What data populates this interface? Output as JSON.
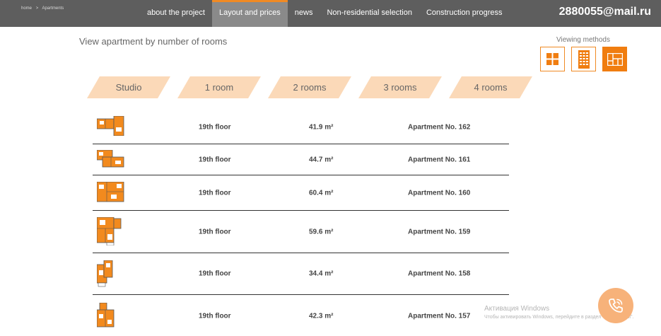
{
  "breadcrumbs": [
    "home",
    ">",
    "Apartments"
  ],
  "nav": {
    "items": [
      {
        "label": "about the project",
        "active": false
      },
      {
        "label": "Layout and prices",
        "active": true
      },
      {
        "label": "news",
        "active": false
      },
      {
        "label": "Non-residential selection",
        "active": false
      },
      {
        "label": "Construction progress",
        "active": false
      }
    ],
    "email": "2880055@mail.ru"
  },
  "section_title": "View apartment by number of rooms",
  "viewing": {
    "label": "Viewing methods",
    "modes": [
      "grid-view-icon",
      "building-facade-icon",
      "floor-plan-view-icon"
    ],
    "active_mode": "floor-plan-view-icon"
  },
  "room_tabs": [
    "Studio",
    "1 room",
    "2 rooms",
    "3 rooms",
    "4 rooms"
  ],
  "apartments": [
    {
      "floor": "19th floor",
      "area": "41.9 m²",
      "apartment": "Apartment No. 162"
    },
    {
      "floor": "19th floor",
      "area": "44.7 m²",
      "apartment": "Apartment No. 161"
    },
    {
      "floor": "19th floor",
      "area": "60.4 m²",
      "apartment": "Apartment No. 160"
    },
    {
      "floor": "19th floor",
      "area": "59.6 m²",
      "apartment": "Apartment No. 159"
    },
    {
      "floor": "19th floor",
      "area": "34.4 m²",
      "apartment": "Apartment No. 158"
    },
    {
      "floor": "19th floor",
      "area": "42.3 m²",
      "apartment": "Apartment No. 157"
    }
  ],
  "windows_watermark": {
    "line1": "Активация Windows",
    "line2": "Чтобы активировать Windows, перейдите в раздел \"Параметры\"."
  },
  "call_button_icon": "phone-call-icon",
  "colors": {
    "accent": "#f07d10",
    "tab_fill": "#fbd9b8",
    "topbar": "#5e5e5e",
    "plan_orange": "#f28a1e"
  }
}
